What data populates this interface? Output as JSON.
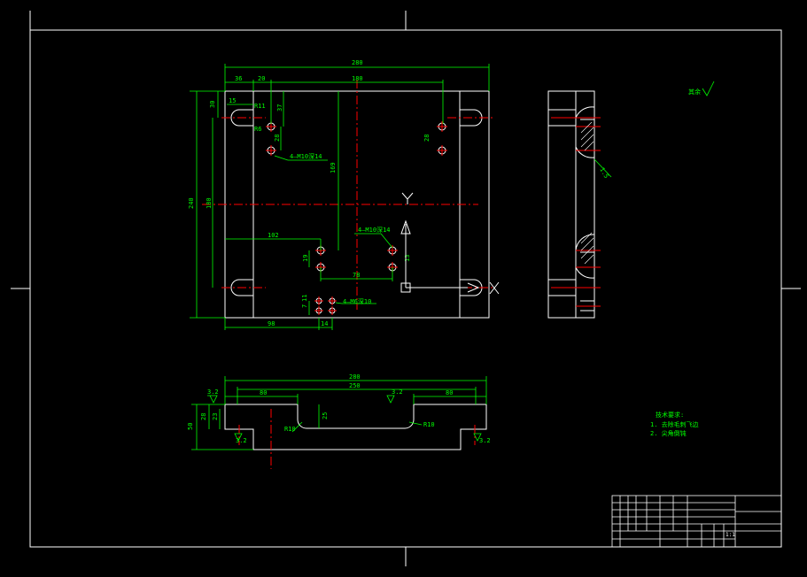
{
  "colors": {
    "background": "#000000",
    "outline": "#ffffff",
    "dimension": "#00ff00",
    "centerline": "#ff0000",
    "leader": "#00ffff"
  },
  "top_view": {
    "dims": {
      "overall_width": "280",
      "width_36": "36",
      "width_20": "20",
      "width_180": "180",
      "v30": "30",
      "h15": "15",
      "r11": "R11",
      "r6": "R6",
      "v37": "37",
      "v28a": "28",
      "v28b": "28",
      "v169": "169",
      "overall_height": "240",
      "v180": "180",
      "h102": "102",
      "v19": "19",
      "h78": "78",
      "v13": "13",
      "h98": "98",
      "h14": "14",
      "v7": "7",
      "v11": "11"
    },
    "hole_notes": {
      "m10_top": "4—M10深14",
      "m10_center": "4—M10深14",
      "m6": "4—M6深10"
    }
  },
  "section_view": {
    "dims": {
      "overall_width": "280",
      "inner_width": "250",
      "left_80": "80",
      "right_80": "80",
      "v50": "50",
      "v28": "28",
      "v23": "23",
      "v25": "25",
      "r10_left": "R10",
      "r10_right": "R10",
      "rough_left_top": "3.2",
      "rough_right_top": "3.2",
      "rough_left_bottom": "3.2",
      "rough_right_bottom": "3.2"
    }
  },
  "side_view": {
    "chamfer": "1.5"
  },
  "surface_note": "其余",
  "tech_requirements": {
    "title": "技术要求:",
    "items": [
      "1. 去除毛刺飞边",
      "2. 尖角倒钝"
    ]
  },
  "title_block": {
    "sheet_scale": "1:1"
  }
}
